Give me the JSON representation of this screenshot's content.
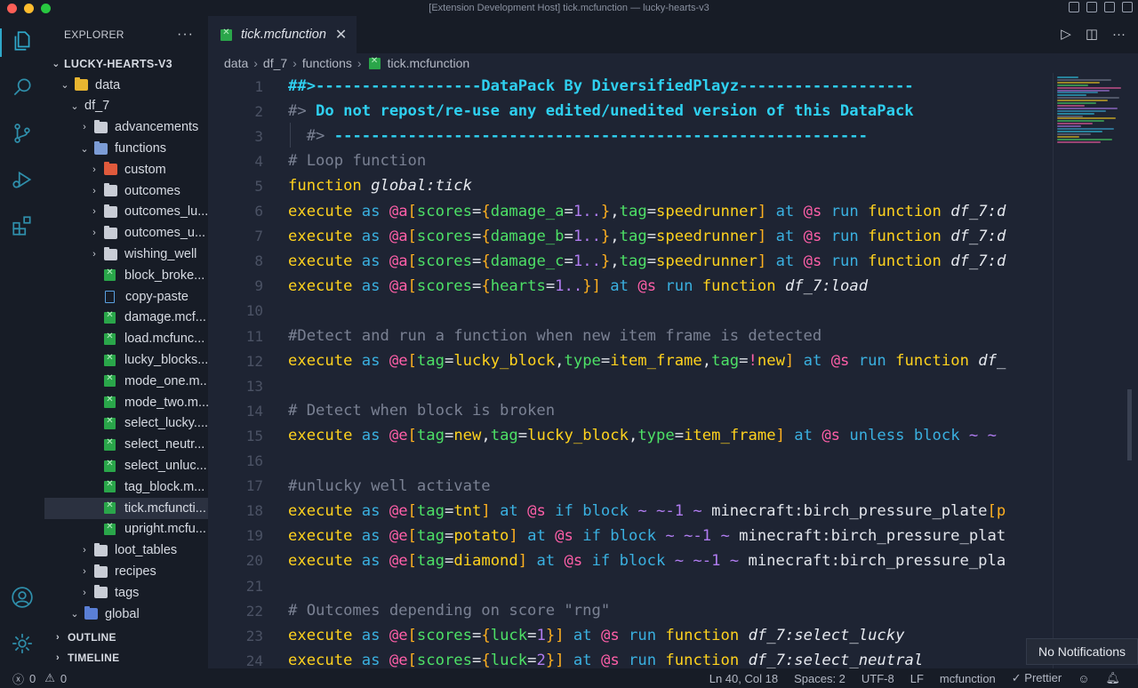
{
  "window": {
    "title": "[Extension Development Host] tick.mcfunction — lucky-hearts-v3"
  },
  "explorer": {
    "title": "EXPLORER",
    "more": "···",
    "root": "LUCKY-HEARTS-V3",
    "items": [
      {
        "label": "data",
        "depth": 1,
        "type": "folder-data",
        "chev": "⌄"
      },
      {
        "label": "df_7",
        "depth": 2,
        "type": "none",
        "chev": "⌄"
      },
      {
        "label": "advancements",
        "depth": 3,
        "type": "folder",
        "chev": "›"
      },
      {
        "label": "functions",
        "depth": 3,
        "type": "folder-fn",
        "chev": "⌄"
      },
      {
        "label": "custom",
        "depth": 4,
        "type": "folder-red",
        "chev": "›"
      },
      {
        "label": "outcomes",
        "depth": 4,
        "type": "folder",
        "chev": "›"
      },
      {
        "label": "outcomes_lu...",
        "depth": 4,
        "type": "folder",
        "chev": "›"
      },
      {
        "label": "outcomes_u...",
        "depth": 4,
        "type": "folder",
        "chev": "›"
      },
      {
        "label": "wishing_well",
        "depth": 4,
        "type": "folder",
        "chev": "›"
      },
      {
        "label": "block_broke...",
        "depth": 4,
        "type": "mc",
        "chev": ""
      },
      {
        "label": "copy-paste",
        "depth": 4,
        "type": "doc",
        "chev": ""
      },
      {
        "label": "damage.mcf...",
        "depth": 4,
        "type": "mc",
        "chev": ""
      },
      {
        "label": "load.mcfunc...",
        "depth": 4,
        "type": "mc",
        "chev": ""
      },
      {
        "label": "lucky_blocks...",
        "depth": 4,
        "type": "mc",
        "chev": ""
      },
      {
        "label": "mode_one.m...",
        "depth": 4,
        "type": "mc",
        "chev": ""
      },
      {
        "label": "mode_two.m...",
        "depth": 4,
        "type": "mc",
        "chev": ""
      },
      {
        "label": "select_lucky....",
        "depth": 4,
        "type": "mc",
        "chev": ""
      },
      {
        "label": "select_neutr...",
        "depth": 4,
        "type": "mc",
        "chev": ""
      },
      {
        "label": "select_unluc...",
        "depth": 4,
        "type": "mc",
        "chev": ""
      },
      {
        "label": "tag_block.m...",
        "depth": 4,
        "type": "mc",
        "chev": ""
      },
      {
        "label": "tick.mcfuncti...",
        "depth": 4,
        "type": "mc",
        "chev": "",
        "selected": true
      },
      {
        "label": "upright.mcfu...",
        "depth": 4,
        "type": "mc",
        "chev": ""
      },
      {
        "label": "loot_tables",
        "depth": 3,
        "type": "folder",
        "chev": "›"
      },
      {
        "label": "recipes",
        "depth": 3,
        "type": "folder",
        "chev": "›"
      },
      {
        "label": "tags",
        "depth": 3,
        "type": "folder",
        "chev": "›"
      },
      {
        "label": "global",
        "depth": 2,
        "type": "folder-blue",
        "chev": "⌄"
      }
    ],
    "outline": "OUTLINE",
    "timeline": "TIMELINE"
  },
  "tab": {
    "label": "tick.mcfunction",
    "close": "✕"
  },
  "breadcrumb": [
    "data",
    "df_7",
    "functions",
    "tick.mcfunction"
  ],
  "code": {
    "lines": [
      {
        "n": "1",
        "segs": [
          [
            "t-head",
            "##>------------------DataPack By DiversifiedPlayz-------------------"
          ]
        ]
      },
      {
        "n": "2",
        "segs": [
          [
            "t-cmt",
            "#> "
          ],
          [
            "t-head",
            "Do not repost/re-use any edited/unedited version of this DataPack"
          ]
        ]
      },
      {
        "n": "3",
        "segs": [
          [
            "t-cmt",
            "  #> "
          ],
          [
            "t-head",
            "----------------------------------------------------------"
          ]
        ]
      },
      {
        "n": "4",
        "segs": [
          [
            "t-cmt",
            "# Loop function"
          ]
        ]
      },
      {
        "n": "5",
        "segs": [
          [
            "t-kw",
            "function "
          ],
          [
            "t-fnid",
            "global:tick"
          ]
        ]
      },
      {
        "n": "6",
        "segs": [
          [
            "t-kw",
            "execute "
          ],
          [
            "t-as",
            "as "
          ],
          [
            "t-sel",
            "@a"
          ],
          [
            "t-br",
            "["
          ],
          [
            "t-key",
            "scores"
          ],
          [
            "t-plain",
            "="
          ],
          [
            "t-br",
            "{"
          ],
          [
            "t-key",
            "damage_a"
          ],
          [
            "t-plain",
            "="
          ],
          [
            "t-num",
            "1.."
          ],
          [
            "t-br",
            "}"
          ],
          [
            "t-plain",
            ","
          ],
          [
            "t-key",
            "tag"
          ],
          [
            "t-plain",
            "="
          ],
          [
            "t-val",
            "speedrunner"
          ],
          [
            "t-br",
            "]"
          ],
          [
            "t-as",
            " at "
          ],
          [
            "t-sel",
            "@s"
          ],
          [
            "t-as",
            " run "
          ],
          [
            "t-kw",
            "function "
          ],
          [
            "t-fnid",
            "df_7:d"
          ]
        ]
      },
      {
        "n": "7",
        "segs": [
          [
            "t-kw",
            "execute "
          ],
          [
            "t-as",
            "as "
          ],
          [
            "t-sel",
            "@a"
          ],
          [
            "t-br",
            "["
          ],
          [
            "t-key",
            "scores"
          ],
          [
            "t-plain",
            "="
          ],
          [
            "t-br",
            "{"
          ],
          [
            "t-key",
            "damage_b"
          ],
          [
            "t-plain",
            "="
          ],
          [
            "t-num",
            "1.."
          ],
          [
            "t-br",
            "}"
          ],
          [
            "t-plain",
            ","
          ],
          [
            "t-key",
            "tag"
          ],
          [
            "t-plain",
            "="
          ],
          [
            "t-val",
            "speedrunner"
          ],
          [
            "t-br",
            "]"
          ],
          [
            "t-as",
            " at "
          ],
          [
            "t-sel",
            "@s"
          ],
          [
            "t-as",
            " run "
          ],
          [
            "t-kw",
            "function "
          ],
          [
            "t-fnid",
            "df_7:d"
          ]
        ]
      },
      {
        "n": "8",
        "segs": [
          [
            "t-kw",
            "execute "
          ],
          [
            "t-as",
            "as "
          ],
          [
            "t-sel",
            "@a"
          ],
          [
            "t-br",
            "["
          ],
          [
            "t-key",
            "scores"
          ],
          [
            "t-plain",
            "="
          ],
          [
            "t-br",
            "{"
          ],
          [
            "t-key",
            "damage_c"
          ],
          [
            "t-plain",
            "="
          ],
          [
            "t-num",
            "1.."
          ],
          [
            "t-br",
            "}"
          ],
          [
            "t-plain",
            ","
          ],
          [
            "t-key",
            "tag"
          ],
          [
            "t-plain",
            "="
          ],
          [
            "t-val",
            "speedrunner"
          ],
          [
            "t-br",
            "]"
          ],
          [
            "t-as",
            " at "
          ],
          [
            "t-sel",
            "@s"
          ],
          [
            "t-as",
            " run "
          ],
          [
            "t-kw",
            "function "
          ],
          [
            "t-fnid",
            "df_7:d"
          ]
        ]
      },
      {
        "n": "9",
        "segs": [
          [
            "t-kw",
            "execute "
          ],
          [
            "t-as",
            "as "
          ],
          [
            "t-sel",
            "@a"
          ],
          [
            "t-br",
            "["
          ],
          [
            "t-key",
            "scores"
          ],
          [
            "t-plain",
            "="
          ],
          [
            "t-br",
            "{"
          ],
          [
            "t-key",
            "hearts"
          ],
          [
            "t-plain",
            "="
          ],
          [
            "t-num",
            "1.."
          ],
          [
            "t-br",
            "}"
          ],
          [
            "t-br",
            "]"
          ],
          [
            "t-as",
            " at "
          ],
          [
            "t-sel",
            "@s"
          ],
          [
            "t-as",
            " run "
          ],
          [
            "t-kw",
            "function "
          ],
          [
            "t-fnid",
            "df_7:load"
          ]
        ]
      },
      {
        "n": "10",
        "segs": []
      },
      {
        "n": "11",
        "segs": [
          [
            "t-cmt",
            "#Detect and run a function when new item frame is detected"
          ]
        ]
      },
      {
        "n": "12",
        "segs": [
          [
            "t-kw",
            "execute "
          ],
          [
            "t-as",
            "as "
          ],
          [
            "t-sel",
            "@e"
          ],
          [
            "t-br",
            "["
          ],
          [
            "t-key",
            "tag"
          ],
          [
            "t-plain",
            "="
          ],
          [
            "t-val",
            "lucky_block"
          ],
          [
            "t-plain",
            ","
          ],
          [
            "t-key",
            "type"
          ],
          [
            "t-plain",
            "="
          ],
          [
            "t-val",
            "item_frame"
          ],
          [
            "t-plain",
            ","
          ],
          [
            "t-key",
            "tag"
          ],
          [
            "t-plain",
            "="
          ],
          [
            "t-neg",
            "!"
          ],
          [
            "t-val",
            "new"
          ],
          [
            "t-br",
            "]"
          ],
          [
            "t-as",
            " at "
          ],
          [
            "t-sel",
            "@s"
          ],
          [
            "t-as",
            " run "
          ],
          [
            "t-kw",
            "function "
          ],
          [
            "t-fnid",
            "df_"
          ]
        ]
      },
      {
        "n": "13",
        "segs": []
      },
      {
        "n": "14",
        "segs": [
          [
            "t-cmt",
            "# Detect when block is broken"
          ]
        ]
      },
      {
        "n": "15",
        "segs": [
          [
            "t-kw",
            "execute "
          ],
          [
            "t-as",
            "as "
          ],
          [
            "t-sel",
            "@e"
          ],
          [
            "t-br",
            "["
          ],
          [
            "t-key",
            "tag"
          ],
          [
            "t-plain",
            "="
          ],
          [
            "t-val",
            "new"
          ],
          [
            "t-plain",
            ","
          ],
          [
            "t-key",
            "tag"
          ],
          [
            "t-plain",
            "="
          ],
          [
            "t-val",
            "lucky_block"
          ],
          [
            "t-plain",
            ","
          ],
          [
            "t-key",
            "type"
          ],
          [
            "t-plain",
            "="
          ],
          [
            "t-val",
            "item_frame"
          ],
          [
            "t-br",
            "]"
          ],
          [
            "t-as",
            " at "
          ],
          [
            "t-sel",
            "@s"
          ],
          [
            "t-as",
            " unless block "
          ],
          [
            "t-coord",
            "~ ~"
          ]
        ]
      },
      {
        "n": "16",
        "segs": []
      },
      {
        "n": "17",
        "segs": [
          [
            "t-cmt",
            "#unlucky well activate"
          ]
        ]
      },
      {
        "n": "18",
        "segs": [
          [
            "t-kw",
            "execute "
          ],
          [
            "t-as",
            "as "
          ],
          [
            "t-sel",
            "@e"
          ],
          [
            "t-br",
            "["
          ],
          [
            "t-key",
            "tag"
          ],
          [
            "t-plain",
            "="
          ],
          [
            "t-val",
            "tnt"
          ],
          [
            "t-br",
            "]"
          ],
          [
            "t-as",
            " at "
          ],
          [
            "t-sel",
            "@s"
          ],
          [
            "t-as",
            " if block "
          ],
          [
            "t-coord",
            "~ ~-1 ~"
          ],
          [
            "t-plain",
            " minecraft:birch_pressure_plate"
          ],
          [
            "t-br",
            "[p"
          ]
        ]
      },
      {
        "n": "19",
        "segs": [
          [
            "t-kw",
            "execute "
          ],
          [
            "t-as",
            "as "
          ],
          [
            "t-sel",
            "@e"
          ],
          [
            "t-br",
            "["
          ],
          [
            "t-key",
            "tag"
          ],
          [
            "t-plain",
            "="
          ],
          [
            "t-val",
            "potato"
          ],
          [
            "t-br",
            "]"
          ],
          [
            "t-as",
            " at "
          ],
          [
            "t-sel",
            "@s"
          ],
          [
            "t-as",
            " if block "
          ],
          [
            "t-coord",
            "~ ~-1 ~"
          ],
          [
            "t-plain",
            " minecraft:birch_pressure_plat"
          ]
        ]
      },
      {
        "n": "20",
        "segs": [
          [
            "t-kw",
            "execute "
          ],
          [
            "t-as",
            "as "
          ],
          [
            "t-sel",
            "@e"
          ],
          [
            "t-br",
            "["
          ],
          [
            "t-key",
            "tag"
          ],
          [
            "t-plain",
            "="
          ],
          [
            "t-val",
            "diamond"
          ],
          [
            "t-br",
            "]"
          ],
          [
            "t-as",
            " at "
          ],
          [
            "t-sel",
            "@s"
          ],
          [
            "t-as",
            " if block "
          ],
          [
            "t-coord",
            "~ ~-1 ~"
          ],
          [
            "t-plain",
            " minecraft:birch_pressure_pla"
          ]
        ]
      },
      {
        "n": "21",
        "segs": []
      },
      {
        "n": "22",
        "segs": [
          [
            "t-cmt",
            "# Outcomes depending on score \"rng\""
          ]
        ]
      },
      {
        "n": "23",
        "segs": [
          [
            "t-kw",
            "execute "
          ],
          [
            "t-as",
            "as "
          ],
          [
            "t-sel",
            "@e"
          ],
          [
            "t-br",
            "["
          ],
          [
            "t-key",
            "scores"
          ],
          [
            "t-plain",
            "="
          ],
          [
            "t-br",
            "{"
          ],
          [
            "t-key",
            "luck"
          ],
          [
            "t-plain",
            "="
          ],
          [
            "t-num",
            "1"
          ],
          [
            "t-br",
            "}"
          ],
          [
            "t-br",
            "]"
          ],
          [
            "t-as",
            " at "
          ],
          [
            "t-sel",
            "@s"
          ],
          [
            "t-as",
            " run "
          ],
          [
            "t-kw",
            "function "
          ],
          [
            "t-fnid",
            "df_7:select_lucky"
          ]
        ]
      },
      {
        "n": "24",
        "segs": [
          [
            "t-kw",
            "execute "
          ],
          [
            "t-as",
            "as "
          ],
          [
            "t-sel",
            "@e"
          ],
          [
            "t-br",
            "["
          ],
          [
            "t-key",
            "scores"
          ],
          [
            "t-plain",
            "="
          ],
          [
            "t-br",
            "{"
          ],
          [
            "t-key",
            "luck"
          ],
          [
            "t-plain",
            "="
          ],
          [
            "t-num",
            "2"
          ],
          [
            "t-br",
            "}"
          ],
          [
            "t-br",
            "]"
          ],
          [
            "t-as",
            " at "
          ],
          [
            "t-sel",
            "@s"
          ],
          [
            "t-as",
            " run "
          ],
          [
            "t-kw",
            "function "
          ],
          [
            "t-fnid",
            "df_7:select_neutral"
          ]
        ]
      }
    ]
  },
  "status": {
    "errors": "0",
    "warnings": "0",
    "position": "Ln 40, Col 18",
    "spaces": "Spaces: 2",
    "encoding": "UTF-8",
    "eol": "LF",
    "language": "mcfunction",
    "prettier": "✓ Prettier"
  },
  "toast": "No Notifications",
  "colors": {
    "accent": "#2fa7c9",
    "background": "#1e2433",
    "sidebar": "#171c26"
  }
}
